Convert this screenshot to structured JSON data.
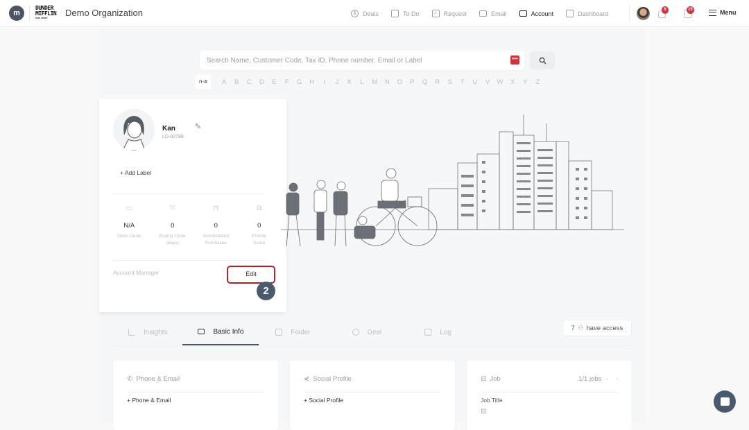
{
  "header": {
    "logo_letter": "m",
    "brand_line1": "DUNDER",
    "brand_line2": "MIFFLIN",
    "brand_sub": "PAPER COMPANY",
    "org_name": "Demo Organization",
    "nav": [
      {
        "label": "Deals",
        "icon": "dollar-circle-icon",
        "active": false
      },
      {
        "label": "To Do",
        "icon": "calendar-icon",
        "active": false
      },
      {
        "label": "Request",
        "icon": "check-square-icon",
        "active": false
      },
      {
        "label": "Email",
        "icon": "envelope-icon",
        "active": false
      },
      {
        "label": "Account",
        "icon": "id-card-icon",
        "active": true
      },
      {
        "label": "Dashboard",
        "icon": "bar-chart-icon",
        "active": false
      }
    ],
    "notifications_count": "5",
    "connections_count": "15",
    "menu_label": "Menu"
  },
  "search": {
    "placeholder": "Search Name, Customer Code, Tax ID, Phone number, Email or Label",
    "value": ""
  },
  "alphabet": {
    "first": "ก-ฮ",
    "letters": [
      "A",
      "B",
      "C",
      "D",
      "E",
      "F",
      "G",
      "H",
      "I",
      "J",
      "K",
      "L",
      "M",
      "N",
      "O",
      "P",
      "Q",
      "R",
      "S",
      "T",
      "U",
      "V",
      "W",
      "X",
      "Y",
      "Z"
    ]
  },
  "profile": {
    "name": "Kan",
    "code": "LD-00799",
    "add_label": "+ Add Label",
    "stats": [
      {
        "value": "N/A",
        "label": "Open Deals"
      },
      {
        "value": "0",
        "label": "Buying Cycle (days)"
      },
      {
        "value": "0",
        "label": "Accumulated Purchases"
      },
      {
        "value": "0",
        "label": "Priority Score"
      }
    ],
    "account_manager_label": "Account Manager",
    "edit_label": "Edit",
    "step_marker": "2"
  },
  "tabs": [
    {
      "label": "Insights",
      "active": false
    },
    {
      "label": "Basic Info",
      "active": true
    },
    {
      "label": "Folder",
      "active": false
    },
    {
      "label": "Deal",
      "active": false
    },
    {
      "label": "Log",
      "active": false
    }
  ],
  "access": {
    "count": "7",
    "label": "have access"
  },
  "cards": {
    "phone": {
      "title": "Phone & Email",
      "add": "+ Phone & Email"
    },
    "social": {
      "title": "Social Profile",
      "add": "+ Social Profile"
    },
    "job": {
      "title": "Job",
      "pager": "1/1 jobs",
      "field_label": "Job Title"
    }
  },
  "colors": {
    "accent": "#4a5a6e",
    "highlight": "#b3222d",
    "badge": "#d1343e"
  }
}
